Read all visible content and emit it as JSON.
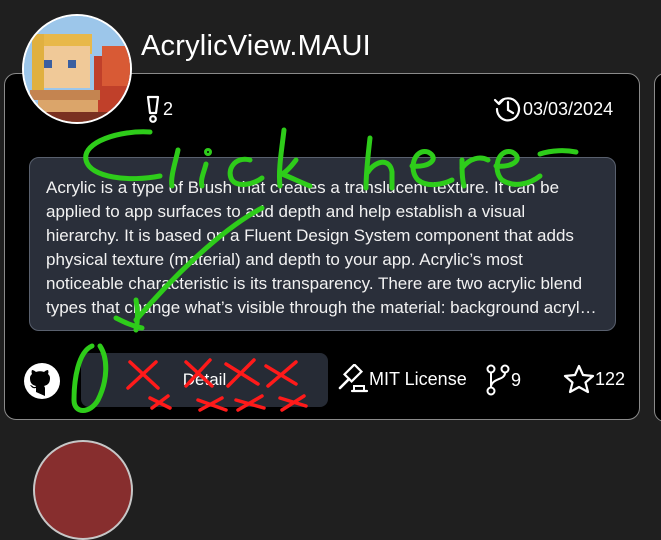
{
  "repo": {
    "title": "AcrylicView.MAUI",
    "issues_count": "2",
    "updated_date": "03/03/2024",
    "description": "Acrylic is a type of Brush that creates a translucent texture. It can be applied to app surfaces to add depth and help establish a visual hierarchy. It is based on a Fluent Design System component that adds physical texture (material) and depth to your app. Acrylic’s most noticeable characteristic is its transparency. There are two acrylic blend types that change what’s visible through the material: background acrylic and in-app acrylic.",
    "detail_label": "Detail",
    "license": "MIT License",
    "forks_count": "9",
    "stars_count": "122"
  },
  "annotation": {
    "handwritten_text": "click here",
    "ink_color": "#2ecc1a",
    "cross_color": "#ff1a1a"
  },
  "icons": [
    "exclamation-icon",
    "history-clock-icon",
    "github-icon",
    "gavel-icon",
    "fork-icon",
    "star-icon"
  ]
}
